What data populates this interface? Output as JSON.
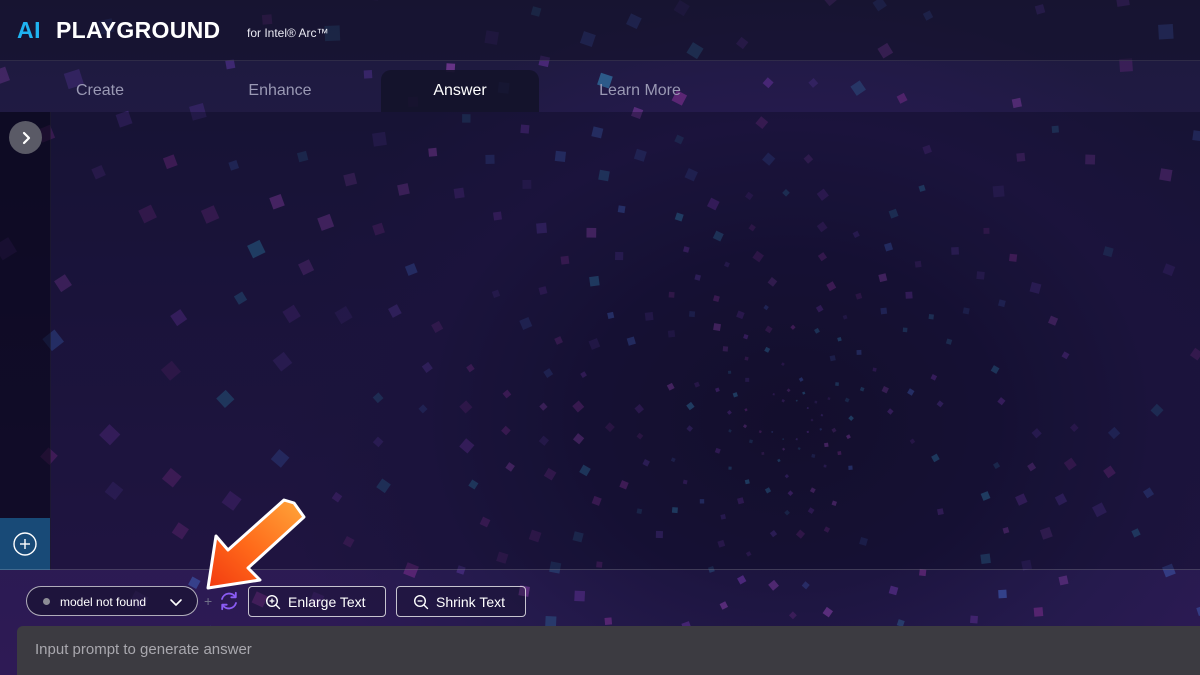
{
  "app": {
    "logo_ai": "AI",
    "logo_name": "PLAYGROUND",
    "logo_sub": "for Intel® Arc™"
  },
  "tabs": [
    {
      "label": "Create",
      "active": false
    },
    {
      "label": "Enhance",
      "active": false
    },
    {
      "label": "Answer",
      "active": true
    },
    {
      "label": "Learn More",
      "active": false
    }
  ],
  "sidebar": {
    "toggle_icon": "chevron-right-icon",
    "add_icon": "plus-circle-icon"
  },
  "toolbar": {
    "model_select_value": "model not found",
    "separator": "+",
    "refresh_icon": "refresh-icon",
    "enlarge_label": "Enlarge Text",
    "shrink_label": "Shrink Text"
  },
  "prompt": {
    "placeholder": "Input prompt to generate answer",
    "value": ""
  },
  "colors": {
    "brand_blue": "#1fb3f0",
    "accent_purple": "#8b5cf6",
    "annotation_orange": "#ff6a1a",
    "add_button_blue": "#184a77"
  }
}
